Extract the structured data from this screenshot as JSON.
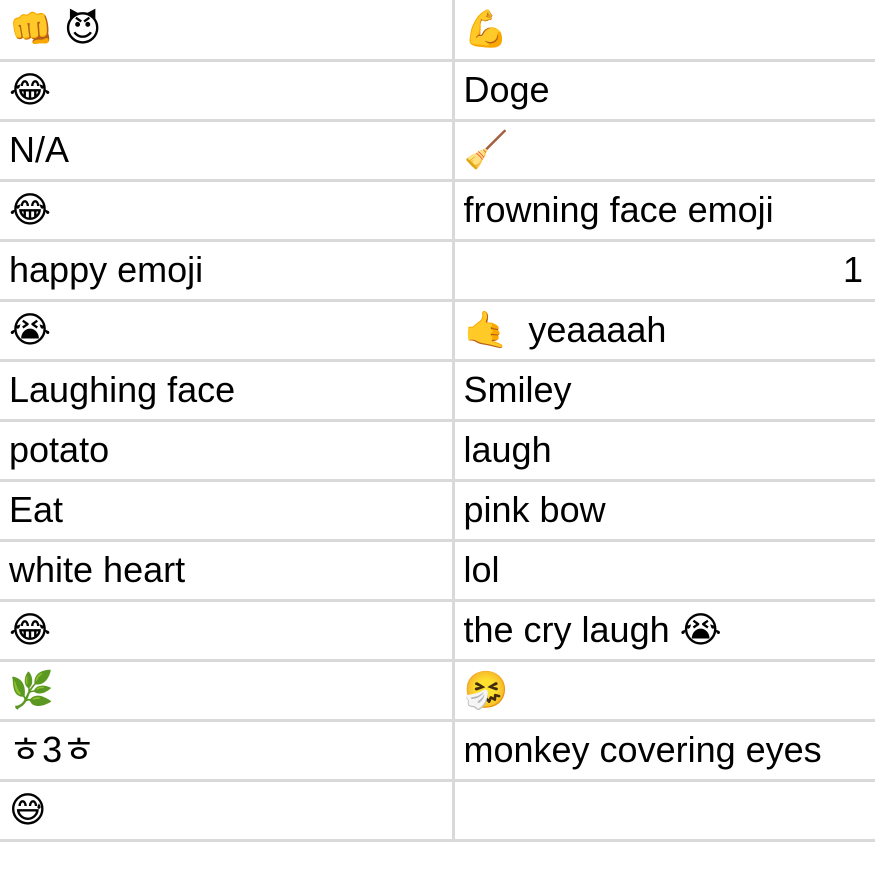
{
  "sheet": {
    "rows": [
      [
        "👊 😈",
        "💪"
      ],
      [
        "😂",
        "Doge"
      ],
      [
        "N/A",
        "🧹"
      ],
      [
        "😂",
        "frowning face emoji"
      ],
      [
        "happy emoji",
        "1"
      ],
      [
        "😭",
        "🤙  yeaaaah"
      ],
      [
        "Laughing face",
        "Smiley"
      ],
      [
        "potato",
        "laugh"
      ],
      [
        "Eat",
        "pink bow"
      ],
      [
        "white heart",
        "lol"
      ],
      [
        "😂",
        "the cry laugh 😭"
      ],
      [
        "🌿",
        "🤧"
      ],
      [
        "ㅎ3ㅎ",
        "monkey covering eyes"
      ],
      [
        "😅",
        ""
      ]
    ]
  },
  "colors": {
    "gridline": "#d9d9d9",
    "background": "#ffffff",
    "text": "#000000"
  }
}
